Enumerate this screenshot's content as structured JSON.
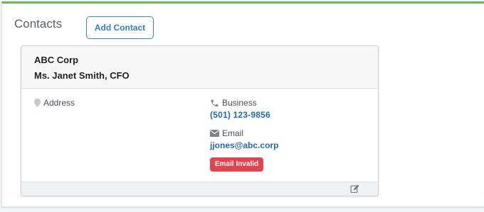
{
  "section": {
    "title": "Contacts",
    "add_button_label": "Add Contact"
  },
  "contact": {
    "company": "ABC Corp",
    "person": "Ms. Janet Smith, CFO",
    "address_label": "Address",
    "business_label": "Business",
    "phone": "(501) 123-9856",
    "email_label": "Email",
    "email": "jjones@abc.corp",
    "email_status": "Email Invalid"
  },
  "icons": {
    "address": "map-pin-icon",
    "business": "phone-icon",
    "email": "envelope-icon",
    "edit": "edit-icon"
  },
  "colors": {
    "accent_bar": "#6bb84f",
    "link": "#2169b4",
    "button": "#2f7ec3",
    "badge_invalid": "#e3434f"
  }
}
